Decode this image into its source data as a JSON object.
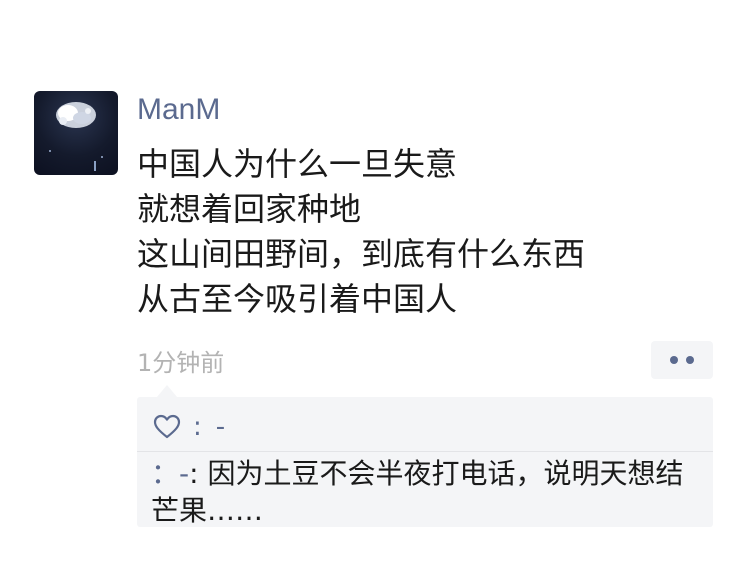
{
  "post": {
    "author": "ManM",
    "avatar_icon": "moon-night-avatar",
    "lines": [
      "中国人为什么一旦失意",
      "就想着回家种地",
      "这山间田野间，到底有什么东西",
      "从古至今吸引着中国人"
    ],
    "timestamp": "1分钟前",
    "more_icon": "two-dots-icon"
  },
  "likes": {
    "icon": "heart-outline-icon",
    "separator": ":",
    "names": "-"
  },
  "comments": [
    {
      "author": "：-",
      "separator": ": ",
      "text": "因为土豆不会半夜打电话，说明天想结芒果……"
    }
  ],
  "colors": {
    "name_blue": "#5b6a8f",
    "text": "#1a1a1a",
    "muted": "#b3b3b3",
    "panel_bg": "#f4f5f7"
  }
}
